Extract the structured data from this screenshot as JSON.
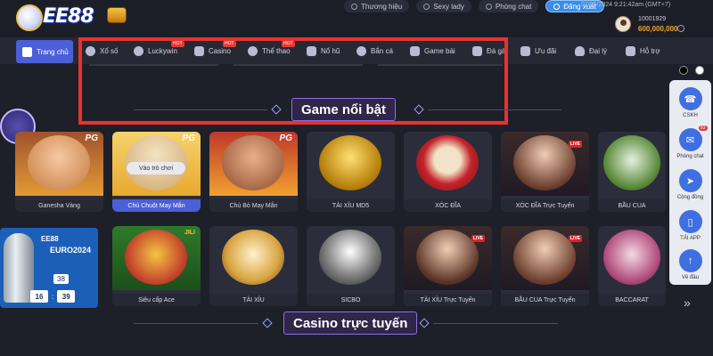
{
  "brand": {
    "logo_text": "EE88"
  },
  "top_links": [
    {
      "label": "Thương hiệu",
      "icon": "brand-icon"
    },
    {
      "label": "Sexy lady",
      "icon": "lady-icon"
    },
    {
      "label": "Phòng chat",
      "icon": "chat-icon"
    },
    {
      "label": "Đăng xuất",
      "icon": "logout-icon"
    }
  ],
  "datetime": "07/05/2024 9:21:42am  (GMT+7)",
  "user": {
    "id": "10001929",
    "balance": "600,000,000"
  },
  "nav": [
    {
      "label": "Trang chủ",
      "icon": "home-icon",
      "hot": false
    },
    {
      "label": "Xổ số",
      "icon": "lottery-icon",
      "hot": false
    },
    {
      "label": "Luckywin",
      "icon": "luckywin-icon",
      "hot": true
    },
    {
      "label": "Casino",
      "icon": "casino-icon",
      "hot": true
    },
    {
      "label": "Thể thao",
      "icon": "sports-icon",
      "hot": true
    },
    {
      "label": "Nổ hũ",
      "icon": "slot-icon",
      "hot": false
    },
    {
      "label": "Bắn cá",
      "icon": "fish-icon",
      "hot": false
    },
    {
      "label": "Game bài",
      "icon": "cards-icon",
      "hot": false
    },
    {
      "label": "Đá gà",
      "icon": "rooster-icon",
      "hot": false
    },
    {
      "label": "Ưu đãi",
      "icon": "gift-icon",
      "hot": false
    },
    {
      "label": "Đại lý",
      "icon": "agent-icon",
      "hot": false
    },
    {
      "label": "Hỗ trợ",
      "icon": "support-icon",
      "hot": false
    }
  ],
  "hot_label": "HOT",
  "sections": {
    "featured": "Game nổi bật",
    "casino": "Casino trực tuyến"
  },
  "play_button": "Vào trò chơi",
  "games_row1": [
    {
      "name": "Ganesha Vàng",
      "provider": "PG"
    },
    {
      "name": "Chú Chuột May Mắn",
      "provider": "PG"
    },
    {
      "name": "Chú Bò May Mắn",
      "provider": "PG"
    },
    {
      "name": "TÀI XỈU MD5",
      "provider": ""
    },
    {
      "name": "XÓC ĐĨA",
      "provider": ""
    },
    {
      "name": "XÓC ĐĨA Trực Tuyến",
      "provider": "LIVE"
    },
    {
      "name": "BẦU CUA",
      "provider": ""
    }
  ],
  "games_row2": [
    {
      "name": "Siêu cấp Ace",
      "provider": "JILI"
    },
    {
      "name": "TÀI XỈU",
      "provider": ""
    },
    {
      "name": "SICBO",
      "provider": ""
    },
    {
      "name": "TÀI XỈU Trực Tuyến",
      "provider": "LIVE"
    },
    {
      "name": "BẦU CUA Trực Tuyến",
      "provider": "LIVE"
    },
    {
      "name": "BACCARAT",
      "provider": ""
    }
  ],
  "promo": {
    "logo": "EE88",
    "title": "EURO2024",
    "date": "38",
    "clock_h": "16",
    "clock_m": "39"
  },
  "float_panel": [
    {
      "label": "CSKH",
      "icon": "headset-icon",
      "badge": ""
    },
    {
      "label": "Phòng chat",
      "icon": "chat-bubble-icon",
      "badge": "83"
    },
    {
      "label": "Cộng đồng",
      "icon": "telegram-icon",
      "badge": ""
    },
    {
      "label": "TẢI APP",
      "icon": "phone-icon",
      "badge": ""
    },
    {
      "label": "Về đầu",
      "icon": "arrow-up-icon",
      "badge": ""
    }
  ],
  "colors": {
    "accent": "#4b5fd8",
    "highlight_box": "#e8322e",
    "balance": "#f2a52b",
    "panel": "#e9ebf3"
  }
}
